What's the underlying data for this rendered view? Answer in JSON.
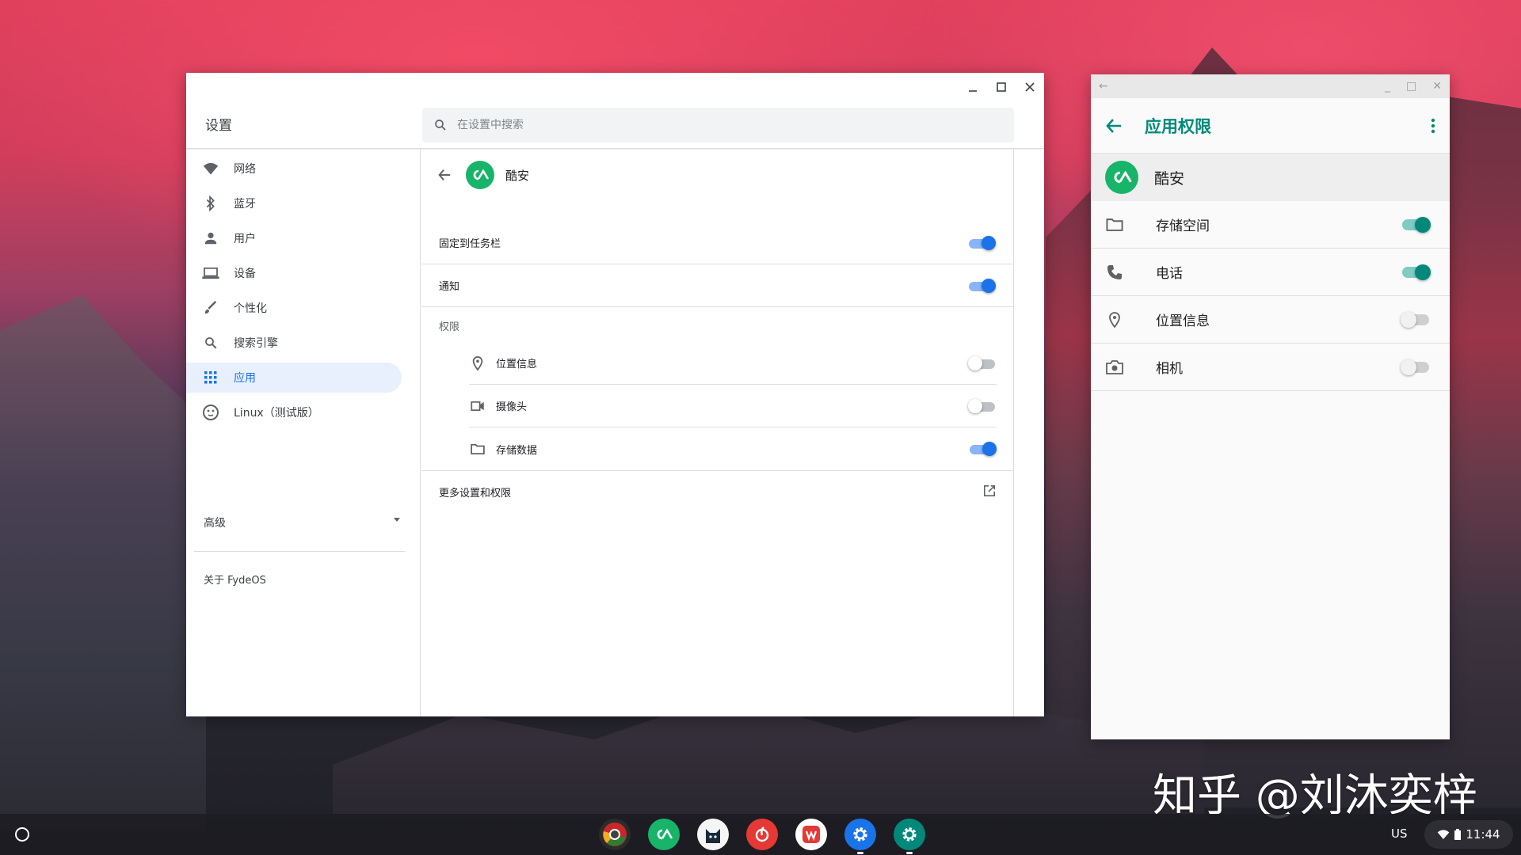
{
  "settings": {
    "title": "设置",
    "search_placeholder": "在设置中搜索",
    "window_controls": [
      "minimize",
      "maximize",
      "close"
    ],
    "nav": [
      {
        "label": "网络",
        "icon": "wifi-icon"
      },
      {
        "label": "蓝牙",
        "icon": "bluetooth-icon"
      },
      {
        "label": "用户",
        "icon": "person-icon"
      },
      {
        "label": "设备",
        "icon": "laptop-icon"
      },
      {
        "label": "个性化",
        "icon": "brush-icon"
      },
      {
        "label": "搜索引擎",
        "icon": "search-icon"
      },
      {
        "label": "应用",
        "icon": "apps-grid-icon",
        "active": true
      },
      {
        "label": "Linux（测试版）",
        "icon": "linux-icon"
      }
    ],
    "advanced_label": "高级",
    "about_label": "关于 FydeOS",
    "app": {
      "name": "酷安",
      "pin_label": "固定到任务栏",
      "pin_on": true,
      "notify_label": "通知",
      "notify_on": true,
      "permissions_label": "权限",
      "permissions": [
        {
          "label": "位置信息",
          "icon": "location-pin-icon",
          "on": false
        },
        {
          "label": "摄像头",
          "icon": "videocam-icon",
          "on": false
        },
        {
          "label": "存储数据",
          "icon": "folder-icon",
          "on": true
        }
      ],
      "more_label": "更多设置和权限"
    }
  },
  "perm_window": {
    "title": "应用权限",
    "app_name": "酷安",
    "rows": [
      {
        "label": "存储空间",
        "icon": "folder-icon",
        "on": true
      },
      {
        "label": "电话",
        "icon": "phone-icon",
        "on": true
      },
      {
        "label": "位置信息",
        "icon": "location-pin-icon",
        "on": false
      },
      {
        "label": "相机",
        "icon": "camera-icon",
        "on": false
      }
    ]
  },
  "watermark": "知乎 @刘沐奕梓",
  "shelf": {
    "apps": [
      "chrome",
      "coolapk",
      "cat-app",
      "netease-music",
      "wps-office",
      "chrome-settings",
      "android-settings"
    ],
    "colors": {
      "accent_blue": "#1a73e8",
      "android_teal": "#00897b",
      "coolapk_green": "#17b469"
    },
    "lang": "US",
    "time": "11:44"
  }
}
